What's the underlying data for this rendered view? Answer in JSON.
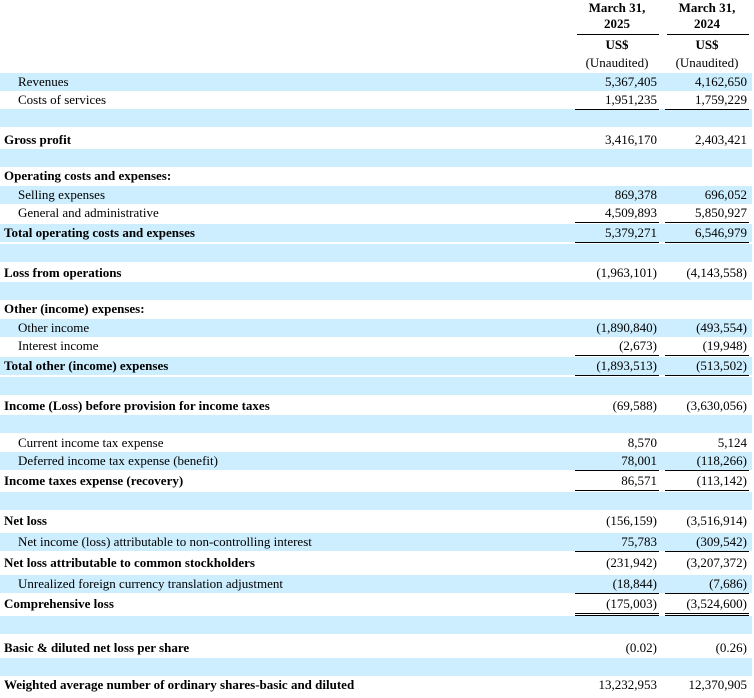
{
  "header": {
    "col1_line1": "March 31,",
    "col1_line2": "2025",
    "col2_line1": "March 31,",
    "col2_line2": "2024",
    "currency": "US$",
    "unaudited": "(Unaudited)"
  },
  "rows": [
    {
      "label": "Revenues",
      "v1": "5,367,405",
      "v2": "4,162,650"
    },
    {
      "label": "Costs of services",
      "v1": "1,951,235",
      "v2": "1,759,229"
    },
    {
      "label": "Gross profit",
      "v1": "3,416,170",
      "v2": "2,403,421"
    },
    {
      "label": "Operating costs and expenses:"
    },
    {
      "label": "Selling expenses",
      "v1": "869,378",
      "v2": "696,052"
    },
    {
      "label": "General and administrative",
      "v1": "4,509,893",
      "v2": "5,850,927"
    },
    {
      "label": "Total operating costs and expenses",
      "v1": "5,379,271",
      "v2": "6,546,979"
    },
    {
      "label": "Loss from operations",
      "v1": "(1,963,101)",
      "v2": "(4,143,558)"
    },
    {
      "label": "Other (income) expenses:"
    },
    {
      "label": "Other income",
      "v1": "(1,890,840)",
      "v2": "(493,554)"
    },
    {
      "label": "Interest income",
      "v1": "(2,673)",
      "v2": "(19,948)"
    },
    {
      "label": "Total other (income) expenses",
      "v1": "(1,893,513)",
      "v2": "(513,502)"
    },
    {
      "label": "Income (Loss) before provision for income taxes",
      "v1": "(69,588)",
      "v2": "(3,630,056)"
    },
    {
      "label": "Current income tax expense",
      "v1": "8,570",
      "v2": "5,124"
    },
    {
      "label": "Deferred income tax expense (benefit)",
      "v1": "78,001",
      "v2": "(118,266)"
    },
    {
      "label": "Income taxes expense (recovery)",
      "v1": "86,571",
      "v2": "(113,142)"
    },
    {
      "label": "Net loss",
      "v1": "(156,159)",
      "v2": "(3,516,914)"
    },
    {
      "label": "Net income (loss) attributable to non-controlling interest",
      "v1": "75,783",
      "v2": "(309,542)"
    },
    {
      "label": "Net loss attributable to common stockholders",
      "v1": "(231,942)",
      "v2": "(3,207,372)"
    },
    {
      "label": "Unrealized foreign currency translation adjustment",
      "v1": "(18,844)",
      "v2": "(7,686)"
    },
    {
      "label": "Comprehensive loss",
      "v1": "(175,003)",
      "v2": "(3,524,600)"
    },
    {
      "label": "Basic & diluted net loss per share",
      "v1": "(0.02)",
      "v2": "(0.26)"
    },
    {
      "label": "Weighted average number of ordinary shares-basic and diluted",
      "v1": "13,232,953",
      "v2": "12,370,905"
    }
  ]
}
